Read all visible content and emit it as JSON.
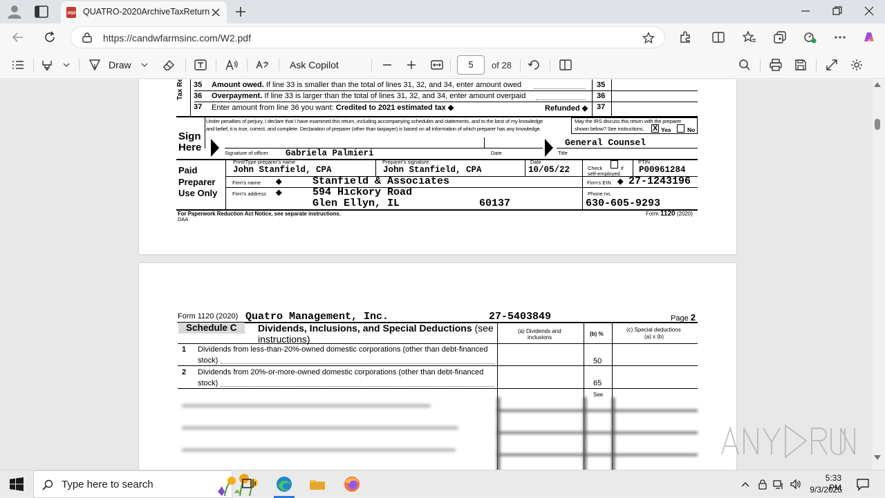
{
  "browser": {
    "tab_title": "QUATRO-2020ArchiveTaxReturn",
    "url": "https://candwfarmsinc.com/W2.pdf"
  },
  "pdf_toolbar": {
    "draw_label": "Draw",
    "ask_copilot_label": "Ask Copilot",
    "current_page": "5",
    "of_pages": "of 28"
  },
  "page1": {
    "side_label": "Tax Re and",
    "lines": [
      {
        "num": "35",
        "bold": "Amount owed.",
        "text": " If line 33 is smaller than the total of lines 31, 32, and 34, enter amount owed",
        "box": "35"
      },
      {
        "num": "36",
        "bold": "Overpayment.",
        "text": " If line 33 is larger than the total of lines 31, 32, and 34, enter amount overpaid",
        "box": "36"
      },
      {
        "num": "37",
        "pre": "Enter amount from line 36 you want:",
        "bold": " Credited to 2021 estimated tax ◆",
        "refunded": "Refunded ◆",
        "box": "37"
      }
    ],
    "perjury_1": "Under penalties of perjury, I declare that I have examined this return, including accompanying schedules and statements, and to the best of my knowledge",
    "perjury_2": "and belief, it is true, correct, and complete. Declaration of preparer (other than taxpayer) is based on all information of which preparer has any knowledge.",
    "irs_discuss_1": "May the IRS discuss this return with the preparer",
    "irs_discuss_2": "shown below? See instructions.",
    "yes_label": "Yes",
    "no_label": "No",
    "yes_mark": "X",
    "sign": "Sign",
    "here": "Here",
    "sig_officer_label": "Signature of officer",
    "officer_name": "Gabriela Palmieri",
    "date_label": "Date",
    "title_label": "Title",
    "officer_title": "General Counsel",
    "paid": "Paid",
    "preparer": "Preparer",
    "use_only": "Use Only",
    "print_name_label": "Print/Type preparer's name",
    "preparer_name": "John Stanfield, CPA",
    "preparer_sig_label": "Preparer's signature",
    "preparer_sig": "John Stanfield, CPA",
    "prep_date_label": "Date",
    "prep_date": "10/05/22",
    "check_label_1": "Check",
    "check_label_2": "if",
    "check_label_3": "self-employed",
    "ptin_label": "PTIN",
    "ptin": "P00961284",
    "firm_name_label": "Firm's name",
    "firm_name": "Stanfield & Associates",
    "firm_ein_label": "Firm's EIN",
    "firm_ein": "27-1243196",
    "firm_addr_label": "Firm's address",
    "firm_addr_1": "594 Hickory Road",
    "firm_addr_2": "Glen Ellyn, IL",
    "firm_zip": "60137",
    "phone_label": "Phone no.",
    "phone": "630-605-9293",
    "paperwork": "For Paperwork Reduction Act Notice, see separate instructions.",
    "daa": "DAA",
    "form_label": "Form",
    "form_num": "1120",
    "form_year": "(2020)"
  },
  "page2": {
    "form_header": "Form 1120 (2020)",
    "company": "Quatro Management, Inc.",
    "ein": "27-5403849",
    "page_label": "Page",
    "page_num": "2",
    "schedule": "Schedule C",
    "schedule_title": "Dividends, Inclusions, and Special Deductions",
    "schedule_see": " (see",
    "schedule_instr": "instructions)",
    "col_a_1": "(a) Dividends and",
    "col_a_2": "inclusions",
    "col_b": "(b) %",
    "col_c_1": "(c) Special deductions",
    "col_c_2": "(a) x (b)",
    "rows": [
      {
        "num": "1",
        "text1": "Dividends from less-than-20%-owned domestic corporations (other than debt-financed",
        "text2": "stock)",
        "pct": "50"
      },
      {
        "num": "2",
        "text1": "Dividends from 20%-or-more-owned domestic corporations (other than debt-financed",
        "text2": "stock)",
        "pct": "65"
      }
    ],
    "see_label": "See"
  },
  "taskbar": {
    "search_placeholder": "Type here to search",
    "time": "5:33 PM",
    "date": "9/3/2025"
  },
  "colors": {
    "accent": "#2b78d8",
    "tab_bg": "#f7f7f7",
    "chrome_bg": "#dfe3e8"
  }
}
